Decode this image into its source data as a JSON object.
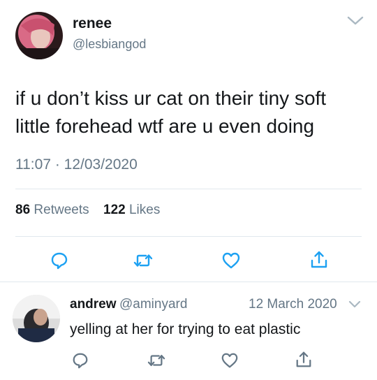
{
  "tweet": {
    "author_name": "renee",
    "author_handle": "@lesbiangod",
    "text_line1": "if u don’t kiss ur cat on their tiny soft",
    "text_line2": "little forehead wtf are u even doing",
    "timestamp": "11:07 · 12/03/2020",
    "retweets_count": "86",
    "retweets_label": "Retweets",
    "likes_count": "122",
    "likes_label": "Likes"
  },
  "reply": {
    "author_name": "andrew",
    "author_handle": "@aminyard",
    "date": "12 March 2020",
    "text": "yelling at her for trying to eat plastic"
  },
  "icons": {
    "menu": "chevron-down-icon",
    "reply": "reply-icon",
    "retweet": "retweet-icon",
    "like": "heart-icon",
    "share": "share-icon"
  },
  "colors": {
    "text": "#14171a",
    "secondary": "#657786",
    "divider": "#e1e8ed"
  }
}
